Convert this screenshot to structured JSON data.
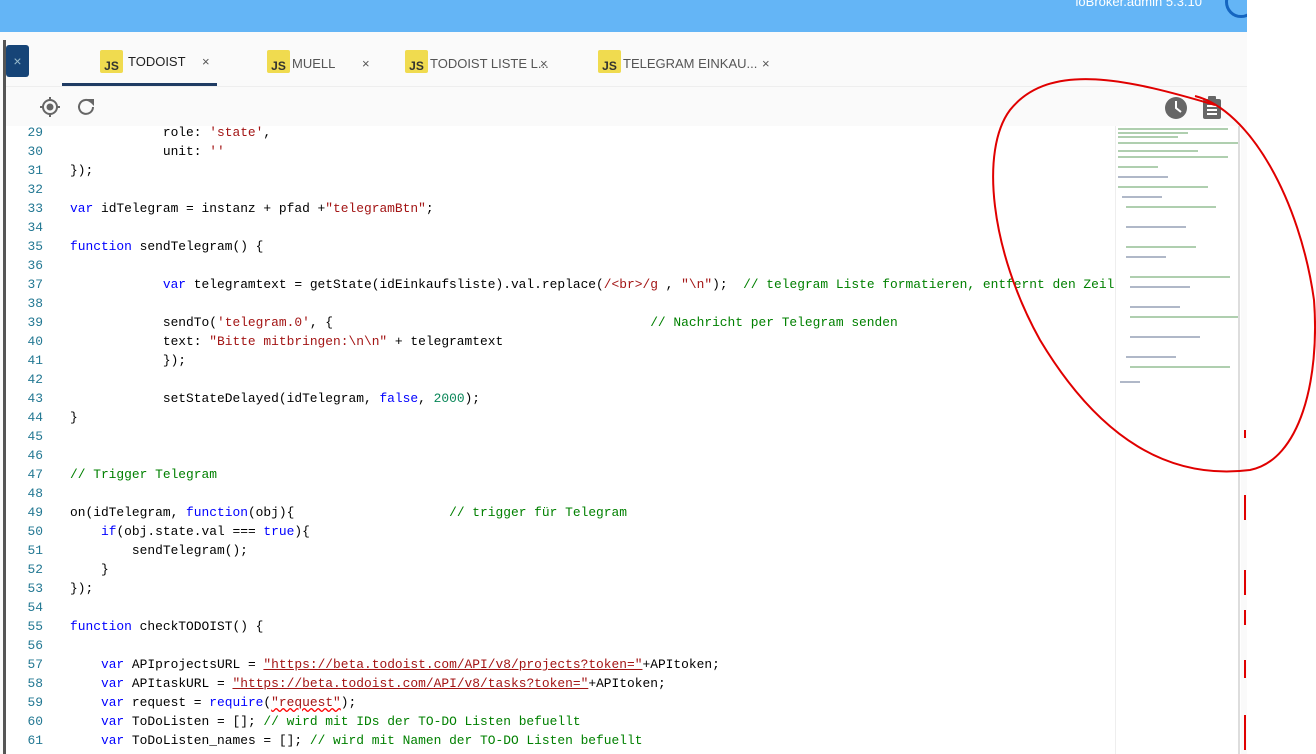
{
  "header": {
    "version": "ioBroker.admin 5.3.10"
  },
  "tabs": [
    {
      "icon": "JS",
      "label": "TODOIST",
      "active": true
    },
    {
      "icon": "JS",
      "label": "MUELL",
      "active": false
    },
    {
      "icon": "JS",
      "label": "TODOIST LISTE L...",
      "active": false
    },
    {
      "icon": "JS",
      "label": "TELEGRAM EINKAU...",
      "active": false
    }
  ],
  "tab_close": "×",
  "side_close": "×",
  "colors": {
    "topbar": "#64b5f6",
    "keyword": "#0000ff",
    "string": "#a31515",
    "comment": "#008000",
    "number": "#098658",
    "annotation": "#e00000"
  },
  "code": [
    {
      "n": "29",
      "t": [
        [
          "t",
          "            role: "
        ],
        [
          "s",
          "'state'"
        ],
        [
          "t",
          ","
        ]
      ]
    },
    {
      "n": "30",
      "t": [
        [
          "t",
          "            unit: "
        ],
        [
          "s",
          "''"
        ]
      ]
    },
    {
      "n": "31",
      "t": [
        [
          "t",
          "});"
        ]
      ]
    },
    {
      "n": "32",
      "t": []
    },
    {
      "n": "33",
      "t": [
        [
          "k",
          "var"
        ],
        [
          "t",
          " idTelegram = instanz + pfad +"
        ],
        [
          "s",
          "\"telegramBtn\""
        ],
        [
          "t",
          ";"
        ]
      ]
    },
    {
      "n": "34",
      "t": []
    },
    {
      "n": "35",
      "t": [
        [
          "k",
          "function"
        ],
        [
          "t",
          " sendTelegram() {"
        ]
      ]
    },
    {
      "n": "36",
      "t": []
    },
    {
      "n": "37",
      "t": [
        [
          "t",
          "            "
        ],
        [
          "k",
          "var"
        ],
        [
          "t",
          " telegramtext = getState(idEinkaufsliste).val.replace("
        ],
        [
          "s",
          "/<br>/g"
        ],
        [
          "t",
          " , "
        ],
        [
          "s",
          "\"\\n\""
        ],
        [
          "t",
          ");  "
        ],
        [
          "c",
          "// telegram Liste formatieren, entfernt den Zeile"
        ]
      ]
    },
    {
      "n": "38",
      "t": []
    },
    {
      "n": "39",
      "t": [
        [
          "t",
          "            sendTo("
        ],
        [
          "s",
          "'telegram.0'"
        ],
        [
          "t",
          ", {                                         "
        ],
        [
          "c",
          "// Nachricht per Telegram senden"
        ]
      ]
    },
    {
      "n": "40",
      "t": [
        [
          "t",
          "            text: "
        ],
        [
          "s",
          "\"Bitte mitbringen:\\n\\n\""
        ],
        [
          "t",
          " + telegramtext"
        ]
      ]
    },
    {
      "n": "41",
      "t": [
        [
          "t",
          "            });"
        ]
      ]
    },
    {
      "n": "42",
      "t": []
    },
    {
      "n": "43",
      "t": [
        [
          "t",
          "            setStateDelayed(idTelegram, "
        ],
        [
          "k",
          "false"
        ],
        [
          "t",
          ", "
        ],
        [
          "n",
          "2000"
        ],
        [
          "t",
          ");"
        ]
      ]
    },
    {
      "n": "44",
      "t": [
        [
          "t",
          "}"
        ]
      ]
    },
    {
      "n": "45",
      "t": []
    },
    {
      "n": "46",
      "t": []
    },
    {
      "n": "47",
      "t": [
        [
          "c",
          "// Trigger Telegram"
        ]
      ]
    },
    {
      "n": "48",
      "t": []
    },
    {
      "n": "49",
      "t": [
        [
          "t",
          "on(idTelegram, "
        ],
        [
          "k",
          "function"
        ],
        [
          "t",
          "(obj){                    "
        ],
        [
          "c",
          "// trigger für Telegram"
        ]
      ]
    },
    {
      "n": "50",
      "t": [
        [
          "t",
          "    "
        ],
        [
          "k",
          "if"
        ],
        [
          "t",
          "(obj.state.val === "
        ],
        [
          "k",
          "true"
        ],
        [
          "t",
          "){"
        ]
      ]
    },
    {
      "n": "51",
      "t": [
        [
          "t",
          "        sendTelegram();"
        ]
      ]
    },
    {
      "n": "52",
      "t": [
        [
          "t",
          "    }"
        ]
      ]
    },
    {
      "n": "53",
      "t": [
        [
          "t",
          "});"
        ]
      ]
    },
    {
      "n": "54",
      "t": []
    },
    {
      "n": "55",
      "t": [
        [
          "k",
          "function"
        ],
        [
          "t",
          " checkTODOIST() {"
        ]
      ]
    },
    {
      "n": "56",
      "t": []
    },
    {
      "n": "57",
      "t": [
        [
          "t",
          "    "
        ],
        [
          "k",
          "var"
        ],
        [
          "t",
          " APIprojectsURL = "
        ],
        [
          "s u",
          "\"https://beta.todoist.com/API/v8/projects?token=\""
        ],
        [
          "t",
          "+APItoken;"
        ]
      ]
    },
    {
      "n": "58",
      "t": [
        [
          "t",
          "    "
        ],
        [
          "k",
          "var"
        ],
        [
          "t",
          " APItaskURL = "
        ],
        [
          "s u",
          "\"https://beta.todoist.com/API/v8/tasks?token=\""
        ],
        [
          "t",
          "+APItoken;"
        ]
      ]
    },
    {
      "n": "59",
      "t": [
        [
          "t",
          "    "
        ],
        [
          "k",
          "var"
        ],
        [
          "t",
          " request = "
        ],
        [
          "k",
          "require"
        ],
        [
          "t",
          "("
        ],
        [
          "s w",
          "\"request\""
        ],
        [
          "t",
          ");"
        ]
      ]
    },
    {
      "n": "60",
      "t": [
        [
          "t",
          "    "
        ],
        [
          "k",
          "var"
        ],
        [
          "t",
          " ToDoListen = []; "
        ],
        [
          "c",
          "// wird mit IDs der TO-DO Listen befuellt"
        ]
      ]
    },
    {
      "n": "61",
      "t": [
        [
          "t",
          "    "
        ],
        [
          "k",
          "var"
        ],
        [
          "t",
          " ToDoListen_names = []; "
        ],
        [
          "c",
          "// wird mit Namen der TO-DO Listen befuellt"
        ]
      ]
    }
  ]
}
